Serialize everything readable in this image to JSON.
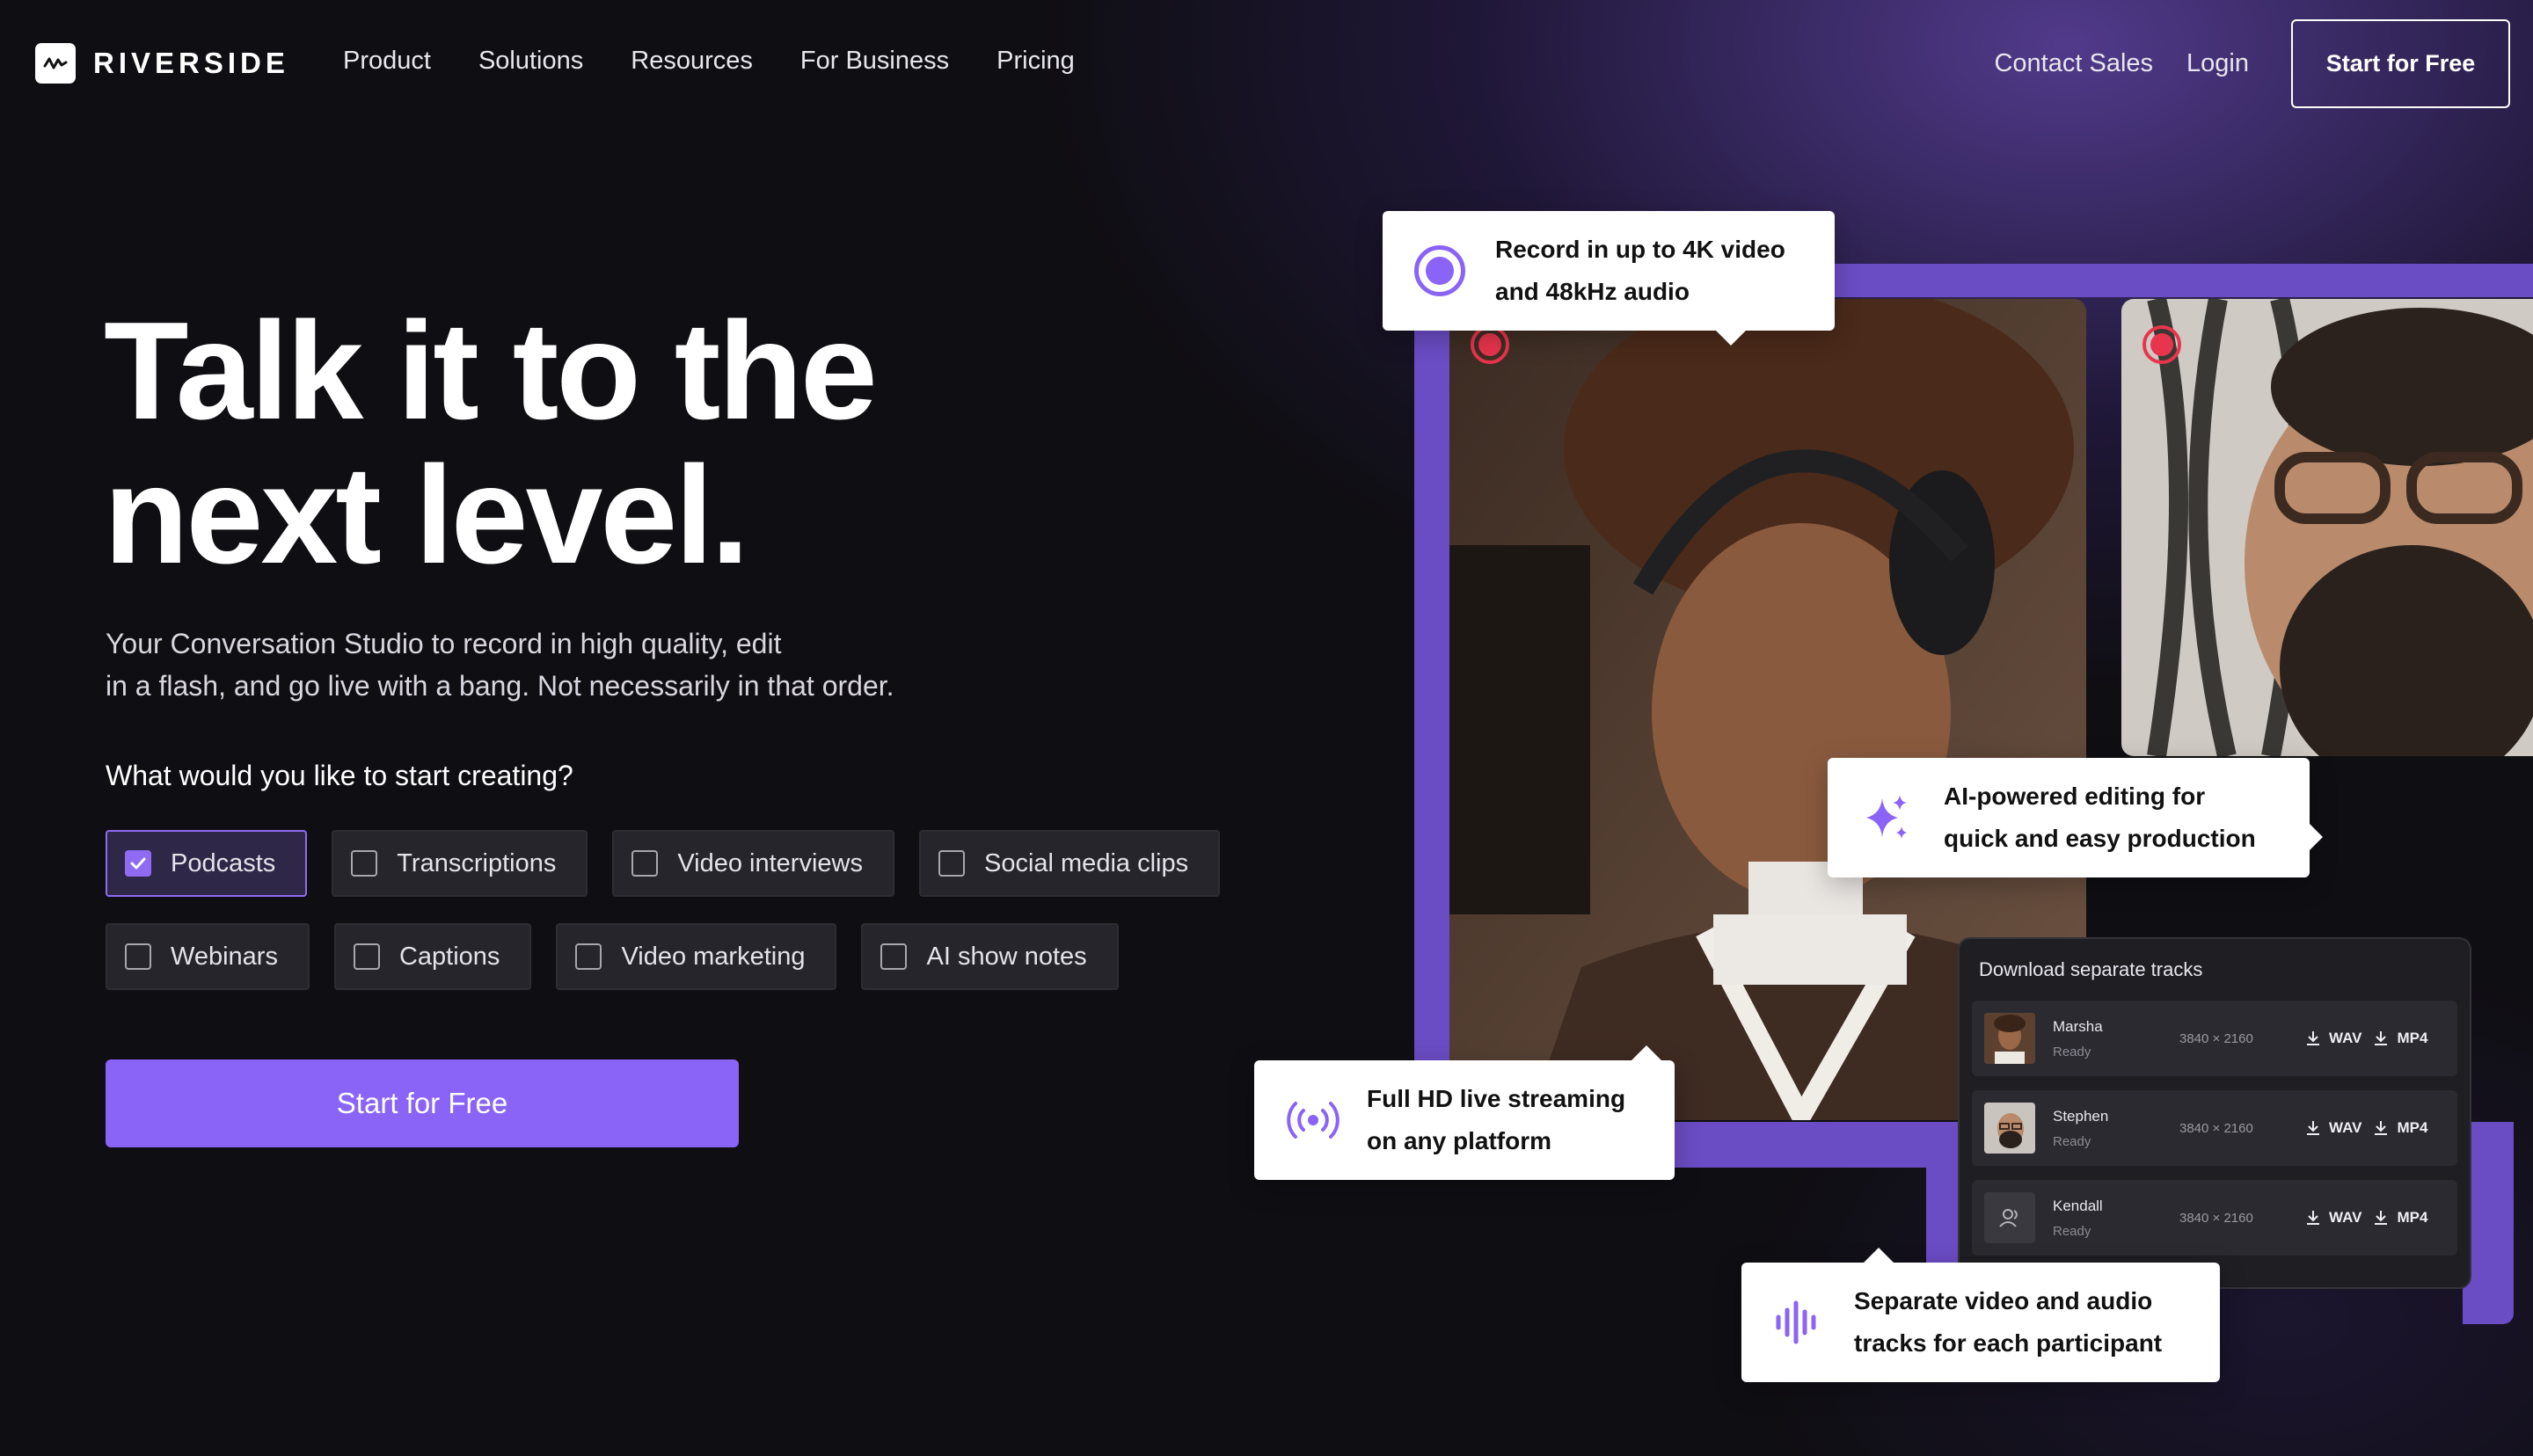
{
  "brand": {
    "name": "RIVERSIDE"
  },
  "nav": {
    "links": [
      "Product",
      "Solutions",
      "Resources",
      "For Business",
      "Pricing"
    ],
    "contact": "Contact Sales",
    "login": "Login",
    "cta": "Start for Free"
  },
  "hero": {
    "headline": [
      "Talk it to the",
      "next level."
    ],
    "subtitle": [
      "Your Conversation Studio to record in high quality, edit",
      "in a flash, and go live with a bang. Not necessarily in that order."
    ],
    "question": "What would you like to start creating?",
    "options_row1": [
      {
        "label": "Podcasts",
        "checked": true
      },
      {
        "label": "Transcriptions",
        "checked": false
      },
      {
        "label": "Video interviews",
        "checked": false
      },
      {
        "label": "Social media clips",
        "checked": false
      }
    ],
    "options_row2": [
      {
        "label": "Webinars",
        "checked": false
      },
      {
        "label": "Captions",
        "checked": false
      },
      {
        "label": "Video marketing",
        "checked": false
      },
      {
        "label": "AI show notes",
        "checked": false
      }
    ],
    "cta": "Start for Free"
  },
  "callouts": {
    "record": [
      "Record in up to 4K video",
      "and 48kHz audio"
    ],
    "ai": [
      "AI-powered editing for",
      "quick and easy production"
    ],
    "stream": [
      "Full HD live streaming",
      "on any platform"
    ],
    "separate": [
      "Separate video and audio",
      "tracks for each participant"
    ]
  },
  "tracks": {
    "title": "Download separate tracks",
    "items": [
      {
        "name": "Marsha",
        "status": "Ready",
        "res": "3840 × 2160",
        "a": "WAV",
        "v": "MP4"
      },
      {
        "name": "Stephen",
        "status": "Ready",
        "res": "3840 × 2160",
        "a": "WAV",
        "v": "MP4"
      },
      {
        "name": "Kendall",
        "status": "Ready",
        "res": "3840 × 2160",
        "a": "WAV",
        "v": "MP4"
      }
    ]
  },
  "colors": {
    "accent": "#8a63f7",
    "frame": "#6a4cc4",
    "record": "#e8344d",
    "background": "#0f0e12"
  }
}
